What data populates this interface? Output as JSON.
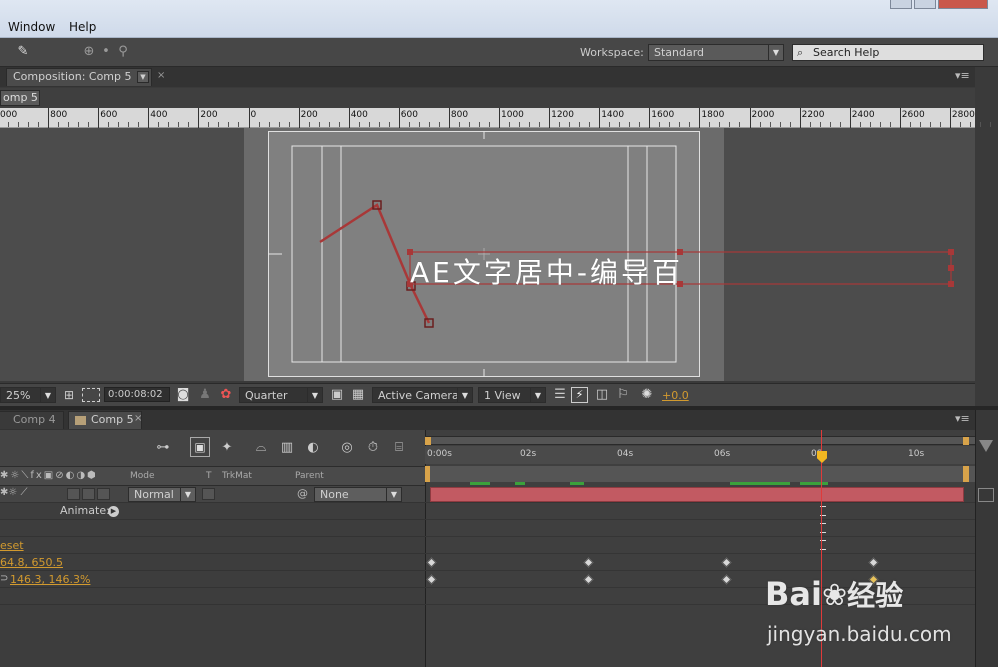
{
  "menu": {
    "items": [
      "Window",
      "Help"
    ]
  },
  "toolbar": {
    "workspace_label": "Workspace:",
    "workspace_value": "Standard",
    "search_placeholder": "Search Help"
  },
  "composition_panel": {
    "tab_label": "Composition: Comp 5",
    "breadcrumb": "omp 5",
    "ruler_labels": [
      "000",
      "800",
      "600",
      "400",
      "200",
      "0",
      "200",
      "400",
      "600",
      "800",
      "1000",
      "1200",
      "1400",
      "1600",
      "1800",
      "2000",
      "2200",
      "2400",
      "2600",
      "2800"
    ],
    "overlay_text": "AE文字居中-编导百",
    "viewer_controls": {
      "zoom": "25%",
      "timecode": "0:00:08:02",
      "resolution": "Quarter",
      "camera": "Active Camera",
      "view": "1 View",
      "exposure": "+0.0"
    }
  },
  "timeline": {
    "tabs": [
      "Comp 4",
      "Comp 5"
    ],
    "columns": {
      "mode": "Mode",
      "t": "T",
      "trkmat": "TrkMat",
      "parent": "Parent"
    },
    "layer": {
      "mode": "Normal",
      "parent": "None"
    },
    "animate_label": "Animate:",
    "properties": [
      {
        "label": "eset"
      },
      {
        "label": "64.8, 650.5"
      },
      {
        "label": "146.3, 146.3%"
      }
    ],
    "time_labels": [
      "0:00s",
      "02s",
      "04s",
      "06s",
      "08s",
      "10s"
    ]
  },
  "colors": {
    "accent_orange": "#d29a2f",
    "cti_red": "#e03a3a",
    "layer_bar": "#c25a62",
    "path_red": "#b03a3a"
  },
  "watermark": {
    "brand": "Bai",
    "brand_cn": "经验",
    "url": "jingyan.baidu.com"
  }
}
